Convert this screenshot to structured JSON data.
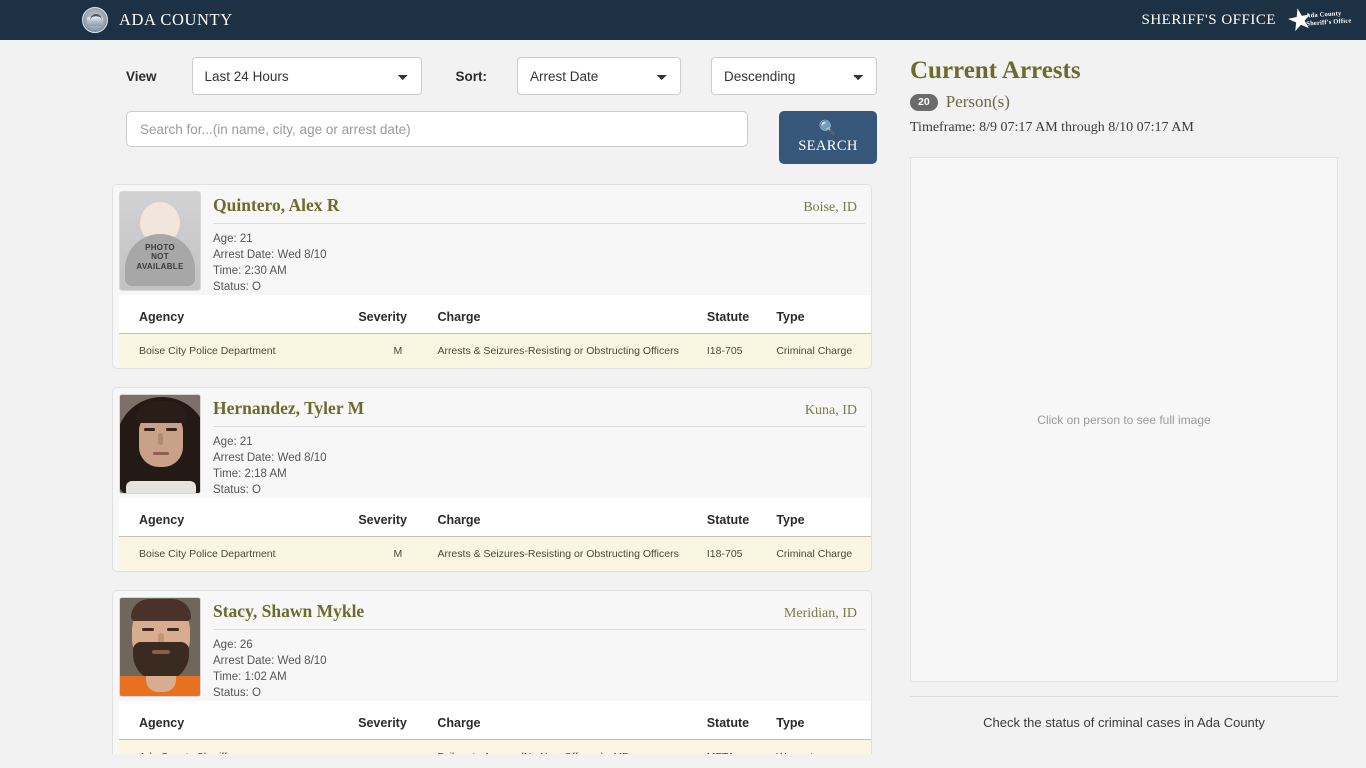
{
  "header": {
    "county_name": "ADA COUNTY",
    "sheriff_text": "SHERIFF'S OFFICE",
    "logo_line1": "Ada County",
    "logo_line2": "Sheriff's Office"
  },
  "filters": {
    "view_label": "View",
    "view_value": "Last 24 Hours",
    "view_options": [
      "Last 24 Hours"
    ],
    "sort_label": "Sort:",
    "sort_value": "Arrest Date",
    "sort_options": [
      "Arrest Date"
    ],
    "direction_value": "Descending",
    "direction_options": [
      "Descending"
    ],
    "search_placeholder": "Search for...(in name, city, age or arrest date)",
    "search_value": "",
    "search_button_label": "SEARCH",
    "search_icon": "search-icon"
  },
  "right_panel": {
    "title": "Current Arrests",
    "count_badge": "20",
    "count_label": "Person(s)",
    "timeframe": "Timeframe: 8/9 07:17 AM through 8/10 07:17 AM",
    "image_placeholder": "Click on person to see full image",
    "footer_text": "Check the status of criminal cases in Ada County"
  },
  "table_headers": {
    "agency": "Agency",
    "severity": "Severity",
    "charge": "Charge",
    "statute": "Statute",
    "type": "Type"
  },
  "arrests": [
    {
      "name": "Quintero, Alex R",
      "city": "Boise, ID",
      "age": "Age: 21",
      "arrest_date": "Arrest Date: Wed 8/10",
      "time": "Time: 2:30 AM",
      "status": "Status: O",
      "photo": "placeholder",
      "photo_text_1": "PHOTO",
      "photo_text_2": "NOT",
      "photo_text_3": "AVAILABLE",
      "charges": [
        {
          "agency": "Boise City Police Department",
          "severity": "M",
          "charge": "Arrests & Seizures-Resisting or Obstructing Officers",
          "statute": "I18-705",
          "type": "Criminal Charge"
        }
      ]
    },
    {
      "name": "Hernandez, Tyler M",
      "city": "Kuna, ID",
      "age": "Age: 21",
      "arrest_date": "Arrest Date: Wed 8/10",
      "time": "Time: 2:18 AM",
      "status": "Status: O",
      "photo": "mugshot-male-long-hair",
      "charges": [
        {
          "agency": "Boise City Police Department",
          "severity": "M",
          "charge": "Arrests & Seizures-Resisting or Obstructing Officers",
          "statute": "I18-705",
          "type": "Criminal Charge"
        }
      ]
    },
    {
      "name": "Stacy, Shawn Mykle",
      "city": "Meridian, ID",
      "age": "Age: 26",
      "arrest_date": "Arrest Date: Wed 8/10",
      "time": "Time: 1:02 AM",
      "status": "Status: O",
      "photo": "mugshot-male-beard-orange",
      "charges": [
        {
          "agency": "Ada County Sheriff",
          "severity": "",
          "charge": "Failure to Appear (No New Offense) - MD",
          "statute": "MFTA",
          "type": "Warrant"
        }
      ]
    }
  ],
  "colors": {
    "header_bg": "#1c3144",
    "accent_olive": "#6b6b2e",
    "search_button": "#36577a",
    "row_highlight": "#fbf6e1",
    "page_bg": "#f2f2f2"
  }
}
